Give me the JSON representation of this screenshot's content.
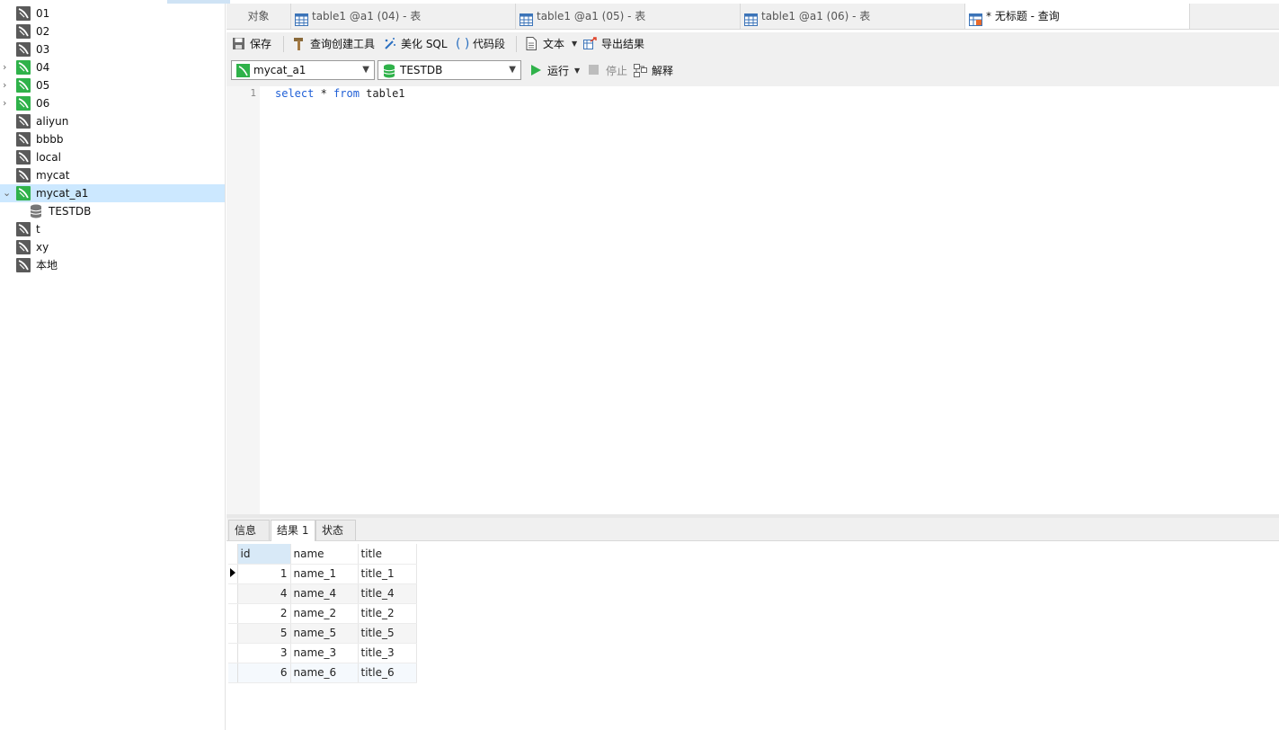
{
  "sidebar": {
    "connections": [
      {
        "label": "01",
        "color": "gray",
        "expand": ""
      },
      {
        "label": "02",
        "color": "gray",
        "expand": ""
      },
      {
        "label": "03",
        "color": "gray",
        "expand": ""
      },
      {
        "label": "04",
        "color": "green",
        "expand": ">"
      },
      {
        "label": "05",
        "color": "green",
        "expand": ">"
      },
      {
        "label": "06",
        "color": "green",
        "expand": ">"
      },
      {
        "label": "aliyun",
        "color": "gray",
        "expand": ""
      },
      {
        "label": "bbbb",
        "color": "gray",
        "expand": ""
      },
      {
        "label": "local",
        "color": "gray",
        "expand": ""
      },
      {
        "label": "mycat",
        "color": "gray",
        "expand": ""
      },
      {
        "label": "mycat_a1",
        "color": "green",
        "expand": "v",
        "selected": true,
        "children": [
          {
            "label": "TESTDB"
          }
        ]
      },
      {
        "label": "t",
        "color": "gray",
        "expand": ""
      },
      {
        "label": "xy",
        "color": "gray",
        "expand": ""
      },
      {
        "label": "本地",
        "color": "gray",
        "expand": ""
      }
    ]
  },
  "tabs": {
    "objects": "对象",
    "items": [
      {
        "label": "table1 @a1 (04) - 表",
        "icon": "table-icon"
      },
      {
        "label": "table1 @a1 (05) - 表",
        "icon": "table-icon"
      },
      {
        "label": "table1 @a1 (06) - 表",
        "icon": "table-icon"
      },
      {
        "label": "* 无标题 - 查询",
        "icon": "query-icon",
        "active": true
      }
    ]
  },
  "toolbar": {
    "save": "保存",
    "query_builder": "查询创建工具",
    "beautify": "美化 SQL",
    "snippet": "代码段",
    "text": "文本",
    "export": "导出结果",
    "connection": "mycat_a1",
    "database": "TESTDB",
    "run": "运行",
    "stop": "停止",
    "explain": "解释"
  },
  "editor": {
    "line_number": "1",
    "code": {
      "kw1": "select",
      "mid": " * ",
      "kw2": "from",
      "rest": " table1"
    }
  },
  "results": {
    "tabs": {
      "info": "信息",
      "result1": "结果 1",
      "status": "状态"
    },
    "columns": [
      "id",
      "name",
      "title"
    ],
    "rows": [
      [
        "1",
        "name_1",
        "title_1"
      ],
      [
        "4",
        "name_4",
        "title_4"
      ],
      [
        "2",
        "name_2",
        "title_2"
      ],
      [
        "5",
        "name_5",
        "title_5"
      ],
      [
        "3",
        "name_3",
        "title_3"
      ],
      [
        "6",
        "name_6",
        "title_6"
      ]
    ]
  },
  "colors": {
    "selected_row": "#cce8ff",
    "green_conn": "#2fb24a",
    "keyword": "#1f5fd6"
  }
}
